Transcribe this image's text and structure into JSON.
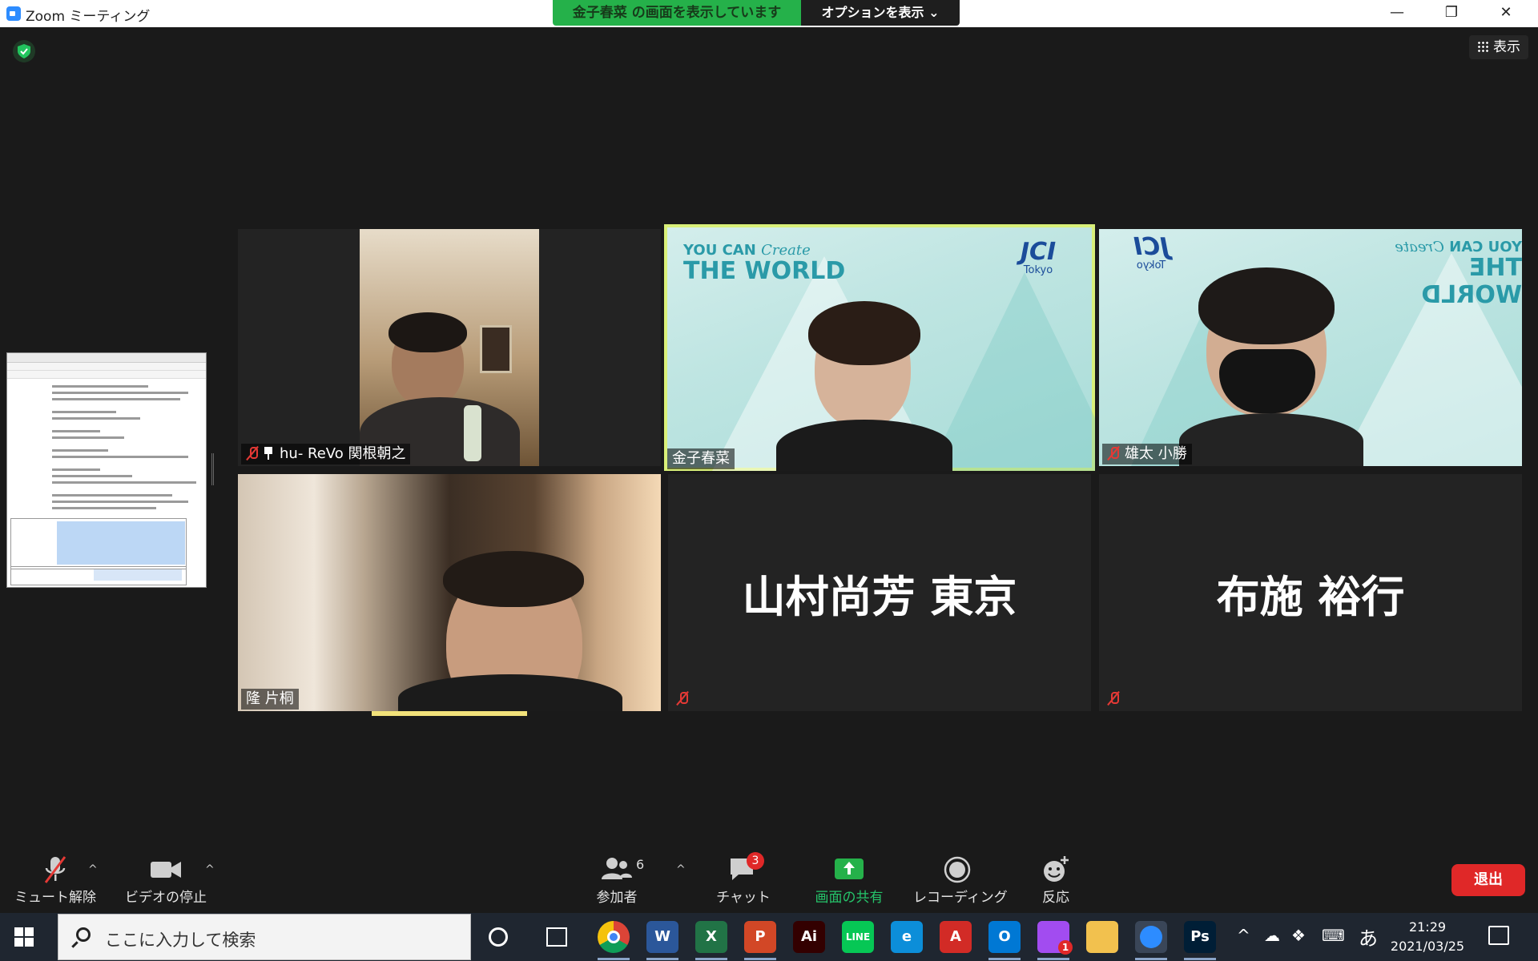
{
  "window": {
    "title": "Zoom ミーティング",
    "share_banner": "金子春菜 の画面を表示しています",
    "options_label": "オプションを表示 ⌄",
    "minimize": "—",
    "maximize": "❐",
    "close": "✕"
  },
  "view": {
    "label": "表示"
  },
  "participants_tiles": [
    {
      "name": "hu- ReVo 関根朝之",
      "muted": true,
      "pinned": true
    },
    {
      "name": "金子春菜",
      "muted": false,
      "active": true
    },
    {
      "name": "雄太 小勝",
      "muted": true
    },
    {
      "name": "隆 片桐",
      "muted": false,
      "speaking": true
    },
    {
      "display_name": "山村尚芳 東京",
      "muted": true
    },
    {
      "display_name": "布施 裕行",
      "muted": true
    }
  ],
  "backgrounds": {
    "tagline_top": "YOU CAN",
    "tagline_script": "Create",
    "tagline_bottom": "THE WORLD",
    "logo": "JCI",
    "logo_sub": "Tokyo"
  },
  "toolbar": {
    "unmute": "ミュート解除",
    "stop_video": "ビデオの停止",
    "participants": "参加者",
    "participants_count": "6",
    "chat": "チャット",
    "chat_badge": "3",
    "share_screen": "画面の共有",
    "recording": "レコーディング",
    "reactions": "反応",
    "leave": "退出"
  },
  "taskbar": {
    "search_placeholder": "ここに入力して検索",
    "time": "21:29",
    "date": "2021/03/25",
    "ime": "あ",
    "apps": [
      {
        "name": "chrome",
        "label": "",
        "color": "#f4c20d"
      },
      {
        "name": "word",
        "label": "W",
        "color": "#2b579a"
      },
      {
        "name": "excel",
        "label": "X",
        "color": "#217346"
      },
      {
        "name": "powerpoint",
        "label": "P",
        "color": "#d24726"
      },
      {
        "name": "illustrator",
        "label": "Ai",
        "color": "#330000"
      },
      {
        "name": "line",
        "label": "LINE",
        "color": "#06c755"
      },
      {
        "name": "edge",
        "label": "e",
        "color": "#0c8ed9"
      },
      {
        "name": "acrobat",
        "label": "A",
        "color": "#d22b26"
      },
      {
        "name": "outlook",
        "label": "O",
        "color": "#0078d4"
      },
      {
        "name": "messenger",
        "label": "",
        "color": "#a24cf0",
        "badge": "1"
      },
      {
        "name": "explorer",
        "label": "",
        "color": "#f2c14e"
      },
      {
        "name": "zoom",
        "label": "",
        "color": "#2d8cff"
      },
      {
        "name": "photoshop",
        "label": "Ps",
        "color": "#001e36"
      }
    ]
  },
  "colors": {
    "share_green": "#25b14a",
    "leave_red": "#e02828",
    "active_border": "#d9f079",
    "muted_red": "#e53935"
  }
}
